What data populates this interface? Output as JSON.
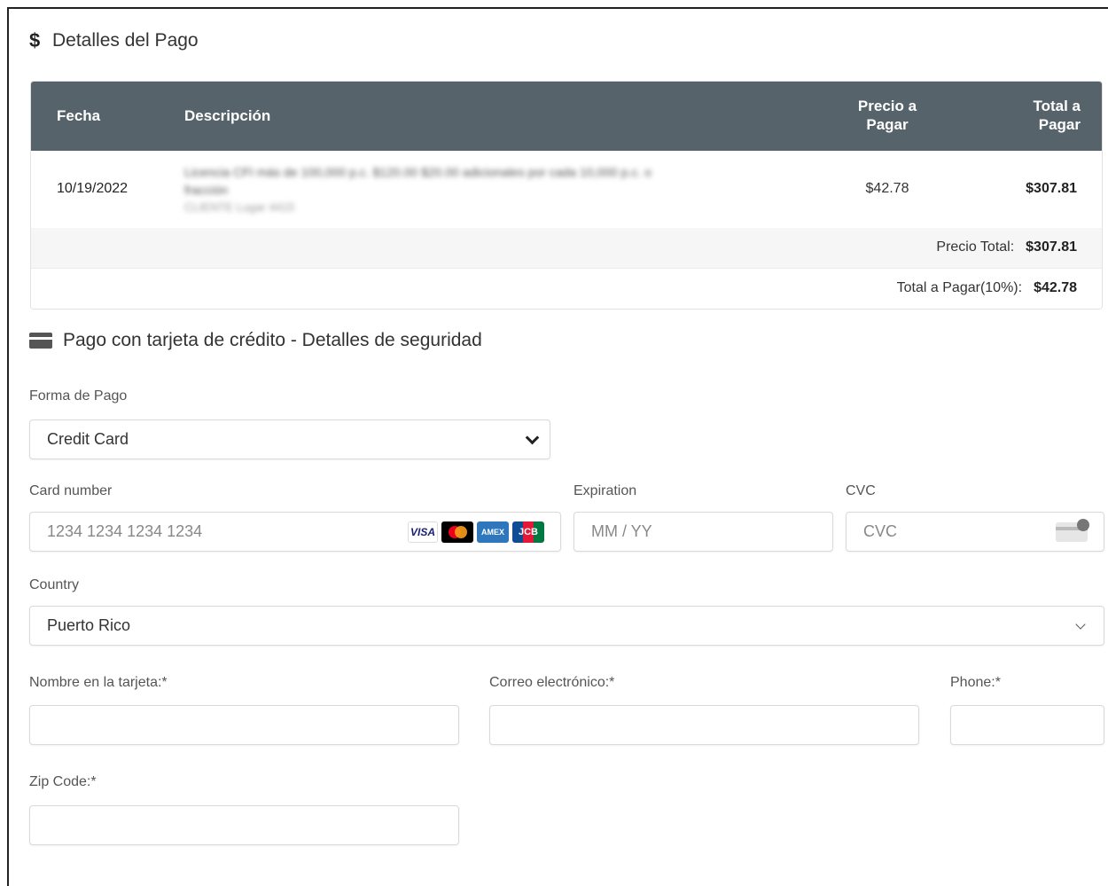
{
  "payment_details": {
    "title": "Detalles del Pago",
    "icon": "dollar-icon",
    "columns": {
      "fecha": "Fecha",
      "descripcion": "Descripción",
      "precio": "Precio a Pagar",
      "total": "Total a Pagar"
    },
    "row": {
      "date": "10/19/2022",
      "description_line1": "Licencia CFI más de 100,000 p.c. $120.00 $20.00 adicionales por cada 10,000 p.c. o",
      "description_line2": "fracción",
      "description_line3": "CLIENTE Lugar 4415",
      "precio": "$42.78",
      "total": "$307.81"
    },
    "summary": {
      "precio_total_label": "Precio Total:",
      "precio_total_value": "$307.81",
      "total_pagar_label": "Total a Pagar(10%):",
      "total_pagar_value": "$42.78"
    }
  },
  "credit_card": {
    "title": "Pago con tarjeta de crédito - Detalles de seguridad",
    "icon": "credit-card-icon",
    "forma_pago_label": "Forma de Pago",
    "forma_pago_value": "Credit Card",
    "card_number_label": "Card number",
    "card_number_placeholder": "1234 1234 1234 1234",
    "brands": {
      "visa": "VISA",
      "amex": "AMEX",
      "jcb": "JCB"
    },
    "expiration_label": "Expiration",
    "expiration_placeholder": "MM / YY",
    "cvc_label": "CVC",
    "cvc_placeholder": "CVC",
    "country_label": "Country",
    "country_value": "Puerto Rico",
    "name_label": "Nombre en la tarjeta:*",
    "email_label": "Correo electrónico:*",
    "phone_label": "Phone:*",
    "zip_label": "Zip Code:*"
  }
}
